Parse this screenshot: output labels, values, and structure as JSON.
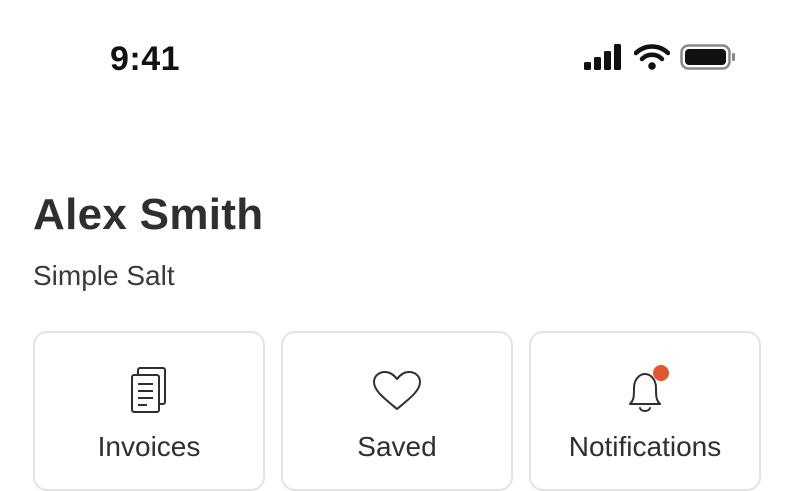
{
  "status_bar": {
    "time": "9:41",
    "icons": [
      "cellular-signal-icon",
      "wifi-icon",
      "battery-icon"
    ]
  },
  "profile": {
    "name": "Alex Smith",
    "business": "Simple Salt"
  },
  "tiles": [
    {
      "label": "Invoices",
      "icon": "invoice-icon"
    },
    {
      "label": "Saved",
      "icon": "heart-icon"
    },
    {
      "label": "Notifications",
      "icon": "bell-icon",
      "badge": true
    }
  ],
  "colors": {
    "notification_badge": "#e4572e",
    "tile_border": "#e3e3e3",
    "text": "#2f2f2f"
  }
}
